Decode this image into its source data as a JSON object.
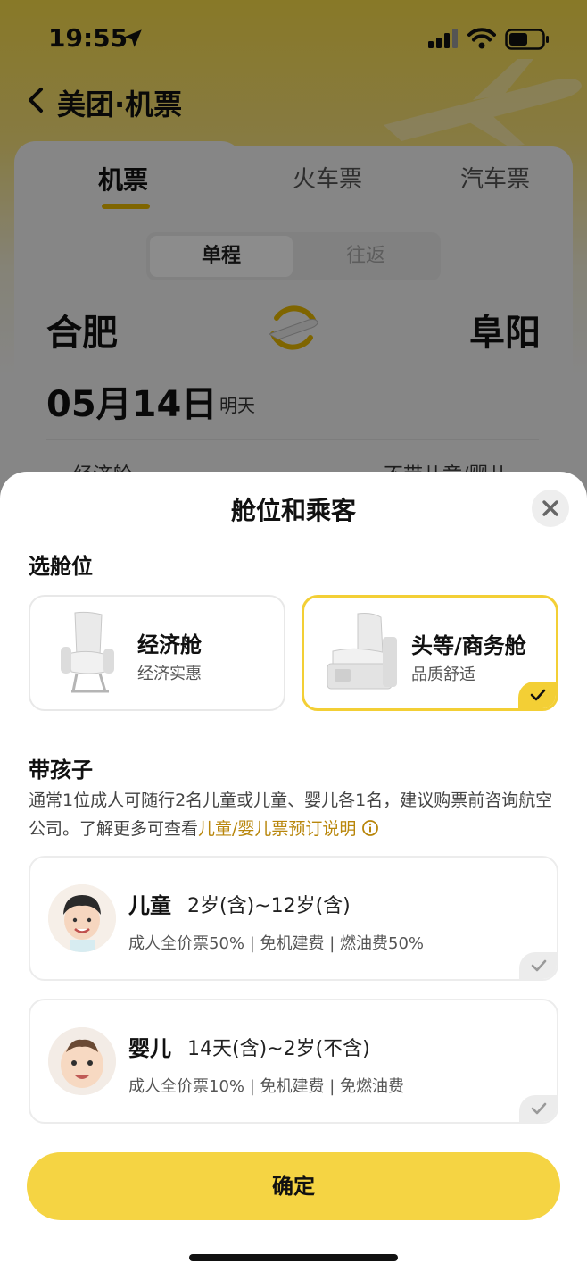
{
  "status_bar": {
    "time": "19:55"
  },
  "app": {
    "title": "美团·机票"
  },
  "tabs": [
    {
      "label": "机票",
      "active": true
    },
    {
      "label": "火车票",
      "active": false
    },
    {
      "label": "汽车票",
      "active": false
    }
  ],
  "trip_type": {
    "one_way": "单程",
    "round_trip": "往返",
    "selected": "单程"
  },
  "route": {
    "from": "合肥",
    "to": "阜阳"
  },
  "date": {
    "main": "05月14日",
    "sub": "明天"
  },
  "peek": {
    "cabin": "经济舱",
    "children": "不带儿童/婴儿"
  },
  "sheet": {
    "title": "舱位和乘客",
    "cabin_section_label": "选舱位",
    "cabins": [
      {
        "name": "经济舱",
        "desc": "经济实惠",
        "selected": false
      },
      {
        "name": "头等/商务舱",
        "desc": "品质舒适",
        "selected": true
      }
    ],
    "kids_section_label": "带孩子",
    "note_text": "通常1位成人可随行2名儿童或儿童、婴儿各1名，建议购票前咨询航空公司。了解更多可查看",
    "note_link": "儿童/婴儿票预订说明",
    "passengers": [
      {
        "name": "儿童",
        "age": "2岁(含)~12岁(含)",
        "desc": "成人全价票50% | 免机建费 | 燃油费50%",
        "selected": false
      },
      {
        "name": "婴儿",
        "age": "14天(含)~2岁(不含)",
        "desc": "成人全价票10% | 免机建费 | 免燃油费",
        "selected": false
      }
    ],
    "confirm_label": "确定"
  },
  "colors": {
    "accent": "#f5d443",
    "link": "#b8860b",
    "selected_border": "#f3cf35"
  }
}
